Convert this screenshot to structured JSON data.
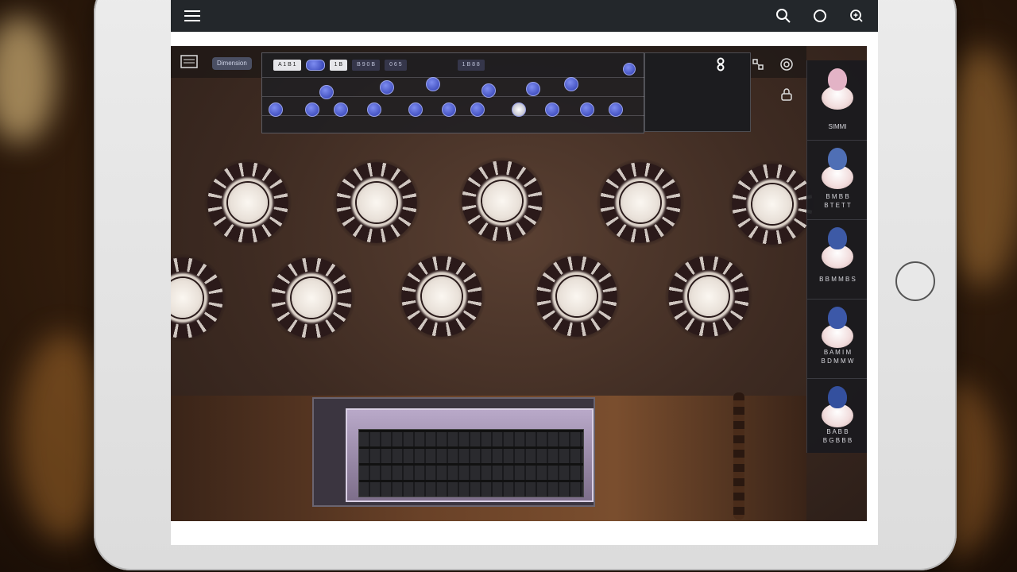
{
  "app": {
    "topbar": {
      "menu_icon": "hamburger-icon",
      "search_icon": "search-icon",
      "circle_icon": "circle-icon",
      "zoom_icon": "zoom-in-icon"
    },
    "viewport": {
      "toolbar_button_label": "Dimension",
      "seat_panel_tags": [
        "A 1 B 1",
        "1 B",
        "B 9 0 B",
        "0 6 5",
        "1 B 8 8"
      ],
      "top_right_icons": [
        "grid-icon",
        "layout-icon",
        "target-icon",
        "lock-icon"
      ]
    },
    "side_panel": {
      "items": [
        {
          "label": "SIMMI",
          "head_color": "#e3b3c6"
        },
        {
          "label": "B M B B\nB T E T T",
          "head_color": "#4f6fb5"
        },
        {
          "label": "B B M M B S",
          "head_color": "#3d5aa6"
        },
        {
          "label": "B A M I M\nB D M M W",
          "head_color": "#3c58a8"
        },
        {
          "label": "B A B B\nB G B B B",
          "head_color": "#34509e"
        }
      ]
    }
  }
}
